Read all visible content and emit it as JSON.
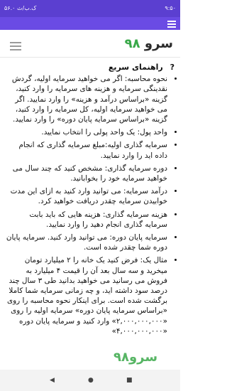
{
  "status": {
    "left": "۵۶.۰ ک.ب/ث",
    "time": "۹:۵۰"
  },
  "app": {
    "logo_text": "سرو",
    "logo_accent": "۹۸"
  },
  "guide": {
    "title": "راهنمای سریع",
    "items": [
      "نحوه محاسبه: اگر می خواهید سرمایه اولیه، گردش نقدینگی سرمایه و هزینه های سرمایه را وارد کنید، گزینه «براساس درآمد و هزینه» را وارد نمایید. اگر می خواهید سرمایه اولیه، کل سرمایه را وارد کنید، گزینه «براساس سرمایه پایان دوره» را وارد نمایید.",
      "واحد پول: یک واحد پولی را انتخاب نمایید.",
      "سرمایه گذاری اولیه:مبلغ سرمایه گذاری که انجام داده اید را وارد نمایید.",
      "دوره سرمایه گذاری: مشخص کنید که چند سال می خواهید سرمایه خود را بخوابانید.",
      "درآمد سرمایه: می توانید وارد کنید به ازای این مدت خوابیدن سرمایه چقدر دریافت خواهید کرد.",
      "هزینه سرمایه گذاری: هزینه هایی که باید بابت سرمایه گذاری انجام دهید را وارد نمایید.",
      "سرمایه پایان دوره: می توانید وارد کنید. سرمایه پایان دوره شما چقدر شده است.",
      "مثال یک: فرض کنید یک خانه را ۲ میلیارد تومان میخرید و سه سال بعد آن را قیمت ۴ میلیارد به فروش می رسانید می خواهید بدانید طی ۳ سال چند درصد سود داشته اید، و چه زمانی سرمایه شما کاملا برگشت شده است. برای اینکار نحوه محاسبه را روی «براساس سرمایه پایان دوره» سرمایه اولیه را روی «۲,۰۰۰,۰۰۰,۰۰۰» وارد کنید و سرمایه پایان دوره «۴,۰۰۰,۰۰۰,۰۰۰»"
    ]
  },
  "watermark": "سرو۹۸",
  "nav": {
    "back": "◀",
    "home": "●",
    "recents": "■"
  }
}
